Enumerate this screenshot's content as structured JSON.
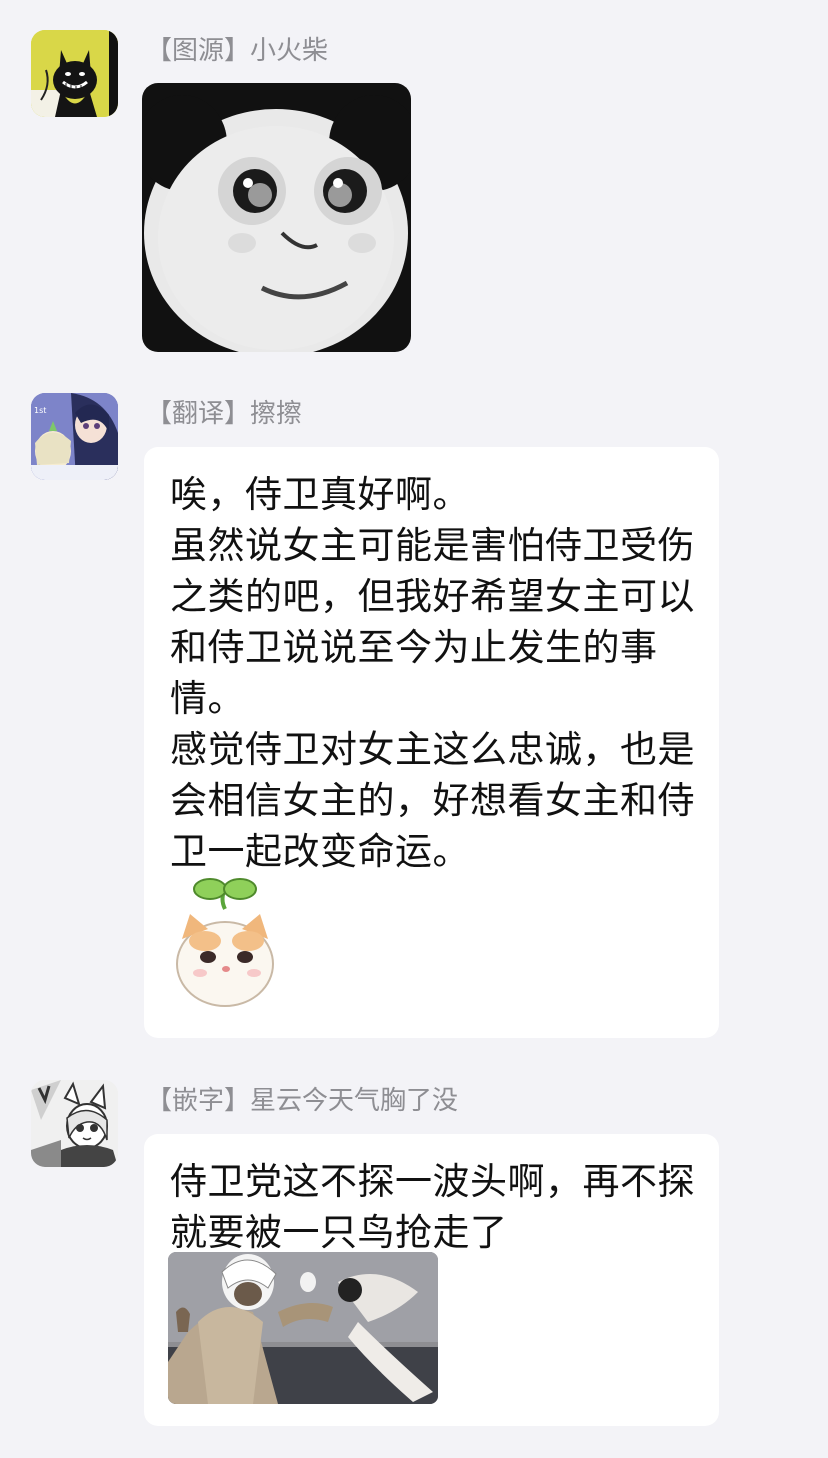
{
  "messages": [
    {
      "sender": "【图源】小火柴",
      "avatar_icon": "black-cat-grin-icon",
      "sticker_icon": "panda-face-meme-icon"
    },
    {
      "sender": "【翻译】擦擦",
      "avatar_icon": "anime-girls-avatar-icon",
      "lines": [
        "唉，侍卫真好啊。",
        "虽然说女主可能是害怕侍卫受伤之类的吧，但我好希望女主可以和侍卫说说至今为止发生的事情。",
        "感觉侍卫对女主这么忠诚，也是会相信女主的，好想看女主和侍卫一起改变命运。"
      ],
      "sticker_icon": "sprout-cat-sticker-icon"
    },
    {
      "sender": "【嵌字】星云今天气胸了没",
      "avatar_icon": "cat-ear-girl-peace-icon",
      "lines": [
        "侍卫党这不探一波头啊，再不探就要被一只鸟抢走了"
      ],
      "sticker_icon": "man-holding-bird-meme-icon"
    }
  ]
}
